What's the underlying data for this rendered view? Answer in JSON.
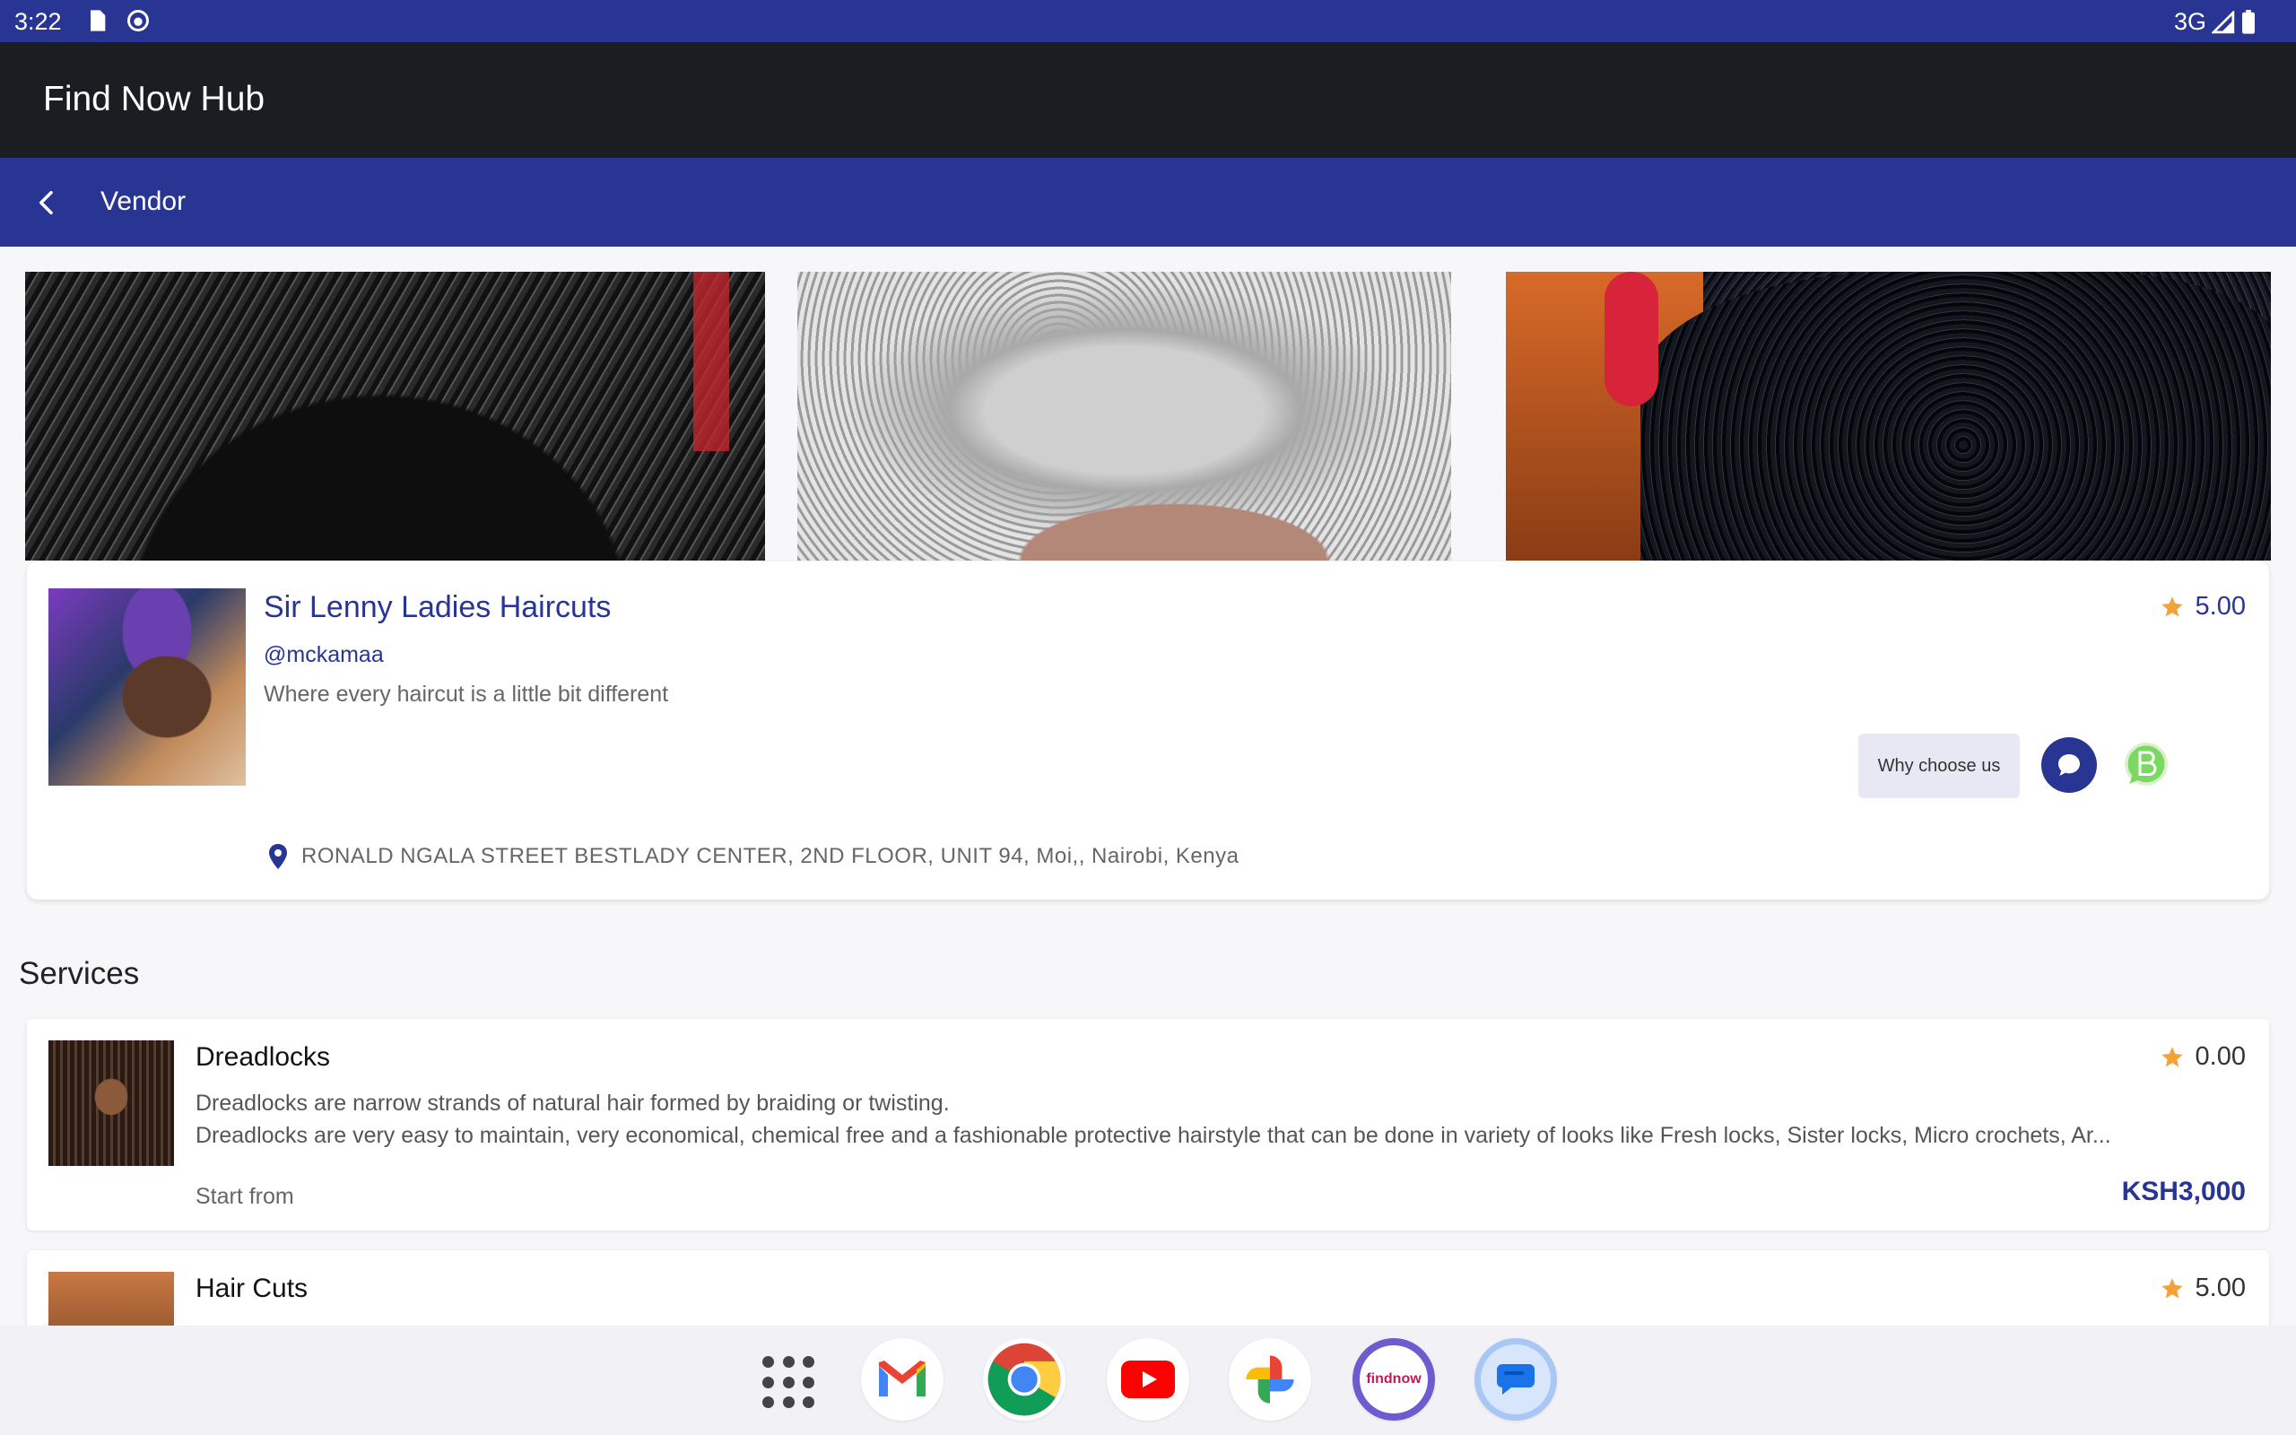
{
  "status_bar": {
    "time": "3:22",
    "network": "3G"
  },
  "app": {
    "title": "Find Now Hub"
  },
  "subheader": {
    "title": "Vendor"
  },
  "vendor": {
    "name": "Sir Lenny Ladies Haircuts",
    "handle": "@mckamaa",
    "tagline": "Where every haircut is a little bit different",
    "rating": "5.00",
    "why_choose_label": "Why choose us",
    "address": "RONALD NGALA STREET BESTLADY CENTER,  2ND FLOOR,  UNIT 94, Moi,, Nairobi, Kenya"
  },
  "services": {
    "title": "Services",
    "items": [
      {
        "name": "Dreadlocks",
        "rating": "0.00",
        "desc_line1": "Dreadlocks are narrow strands of natural hair formed by braiding or twisting.",
        "desc_line2": "Dreadlocks are very easy to maintain, very economical, chemical free and a fashionable protective hairstyle that can be done in variety of looks like Fresh locks, Sister locks, Micro crochets, Ar...",
        "start_label": "Start from",
        "price": "KSH3,000"
      },
      {
        "name": "Hair Cuts",
        "rating": "5.00"
      }
    ]
  },
  "colors": {
    "primary": "#283593",
    "appbar": "#1c1d23",
    "star": "#f4a236"
  },
  "dock": {
    "apps": [
      "app-drawer-icon",
      "gmail-icon",
      "chrome-icon",
      "youtube-icon",
      "photos-icon",
      "findnow-icon",
      "messages-icon"
    ],
    "findnow_logo_text": "findnow"
  }
}
